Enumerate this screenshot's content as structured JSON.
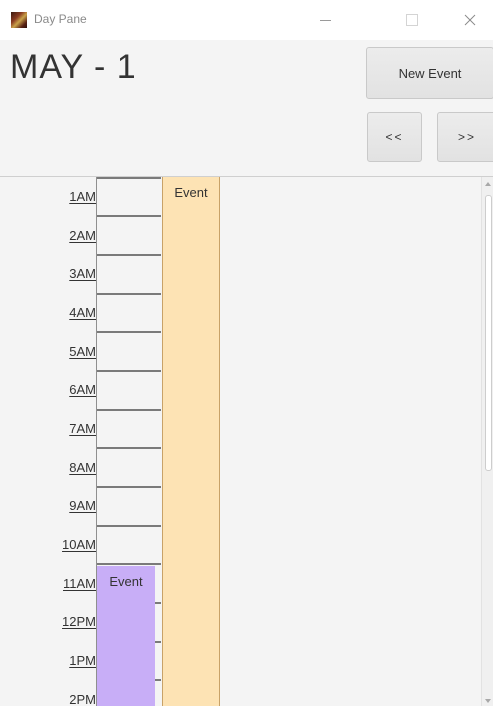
{
  "window": {
    "title": "Day Pane",
    "icon": "app-logo-icon"
  },
  "header": {
    "date": "MAY - 1",
    "new_event_label": "New Event",
    "prev_label": "<<",
    "next_label": ">>"
  },
  "hours": [
    "1AM",
    "2AM",
    "3AM",
    "4AM",
    "5AM",
    "6AM",
    "7AM",
    "8AM",
    "9AM",
    "10AM",
    "11AM",
    "12PM",
    "1PM",
    "2PM"
  ],
  "events": [
    {
      "label": "Event",
      "color": "#fde3b4"
    },
    {
      "label": "Event",
      "color": "#c8aef7"
    }
  ]
}
